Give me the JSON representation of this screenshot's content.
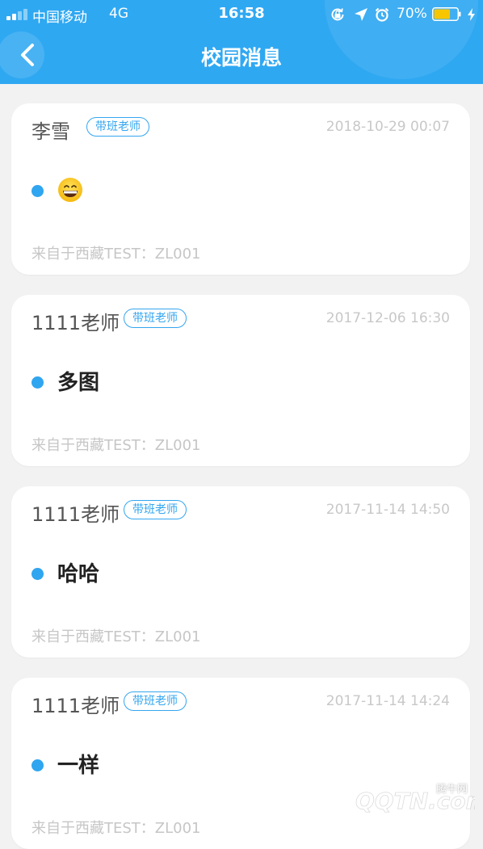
{
  "status_bar": {
    "carrier": "中国移动",
    "network": "4G",
    "time": "16:58",
    "battery_percent": "70%",
    "battery_level": 0.7,
    "icons": [
      "orientation-lock-icon",
      "location-arrow-icon",
      "alarm-clock-icon",
      "battery-icon",
      "charging-bolt-icon"
    ]
  },
  "header": {
    "title": "校园消息",
    "back_icon": "chevron-left-icon",
    "background_color": "#2fa8f2"
  },
  "messages": [
    {
      "sender": "李雪",
      "badge": "带班老师",
      "time": "2018-10-29 00:07",
      "content": "😄",
      "content_icon": "grinning-face-emoji",
      "source": "来自于西藏TEST：ZL001"
    },
    {
      "sender": "1111老师",
      "badge": "带班老师",
      "time": "2017-12-06 16:30",
      "content": "多图",
      "source": "来自于西藏TEST：ZL001"
    },
    {
      "sender": "1111老师",
      "badge": "带班老师",
      "time": "2017-11-14 14:50",
      "content": "哈哈",
      "source": "来自于西藏TEST：ZL001"
    },
    {
      "sender": "1111老师",
      "badge": "带班老师",
      "time": "2017-11-14 14:24",
      "content": "一样",
      "source": "来自于西藏TEST：ZL001"
    }
  ],
  "colors": {
    "accent": "#30a5f0",
    "page_background": "#f2f2f2",
    "muted_text": "#c6c6c6"
  },
  "watermark": {
    "text": "腾牛网",
    "logo_text": "QQTN.com"
  }
}
